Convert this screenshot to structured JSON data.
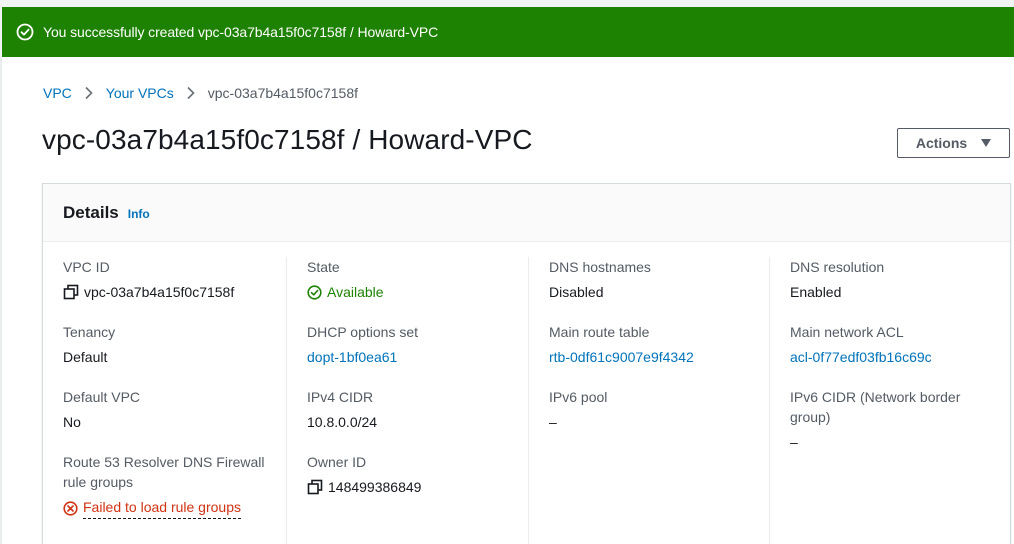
{
  "banner": {
    "message": "You successfully created vpc-03a7b4a15f0c7158f / Howard-VPC",
    "color": "#1d8102",
    "icon": "check-circle-icon"
  },
  "breadcrumb": {
    "items": [
      "VPC",
      "Your VPCs"
    ],
    "current": "vpc-03a7b4a15f0c7158f"
  },
  "page": {
    "title": "vpc-03a7b4a15f0c7158f / Howard-VPC",
    "actions_label": "Actions"
  },
  "details": {
    "title": "Details",
    "info_label": "Info",
    "columns": [
      [
        {
          "label": "VPC ID",
          "value": "vpc-03a7b4a15f0c7158f",
          "copy": true
        },
        {
          "label": "Tenancy",
          "value": "Default"
        },
        {
          "label": "Default VPC",
          "value": "No"
        },
        {
          "label": "Route 53 Resolver DNS Firewall rule groups",
          "value": "Failed to load rule groups",
          "status": "error"
        }
      ],
      [
        {
          "label": "State",
          "value": "Available",
          "status": "success"
        },
        {
          "label": "DHCP options set",
          "value": "dopt-1bf0ea61",
          "link": true
        },
        {
          "label": "IPv4 CIDR",
          "value": "10.8.0.0/24"
        },
        {
          "label": "Owner ID",
          "value": "148499386849",
          "copy": true
        }
      ],
      [
        {
          "label": "DNS hostnames",
          "value": "Disabled"
        },
        {
          "label": "Main route table",
          "value": "rtb-0df61c9007e9f4342",
          "link": true
        },
        {
          "label": "IPv6 pool",
          "value": "–"
        }
      ],
      [
        {
          "label": "DNS resolution",
          "value": "Enabled"
        },
        {
          "label": "Main network ACL",
          "value": "acl-0f77edf03fb16c69c",
          "link": true
        },
        {
          "label": "IPv6 CIDR (Network border group)",
          "value": "–"
        }
      ]
    ]
  },
  "colors": {
    "link": "#0073bb",
    "success": "#1d8102",
    "error": "#d13212"
  }
}
